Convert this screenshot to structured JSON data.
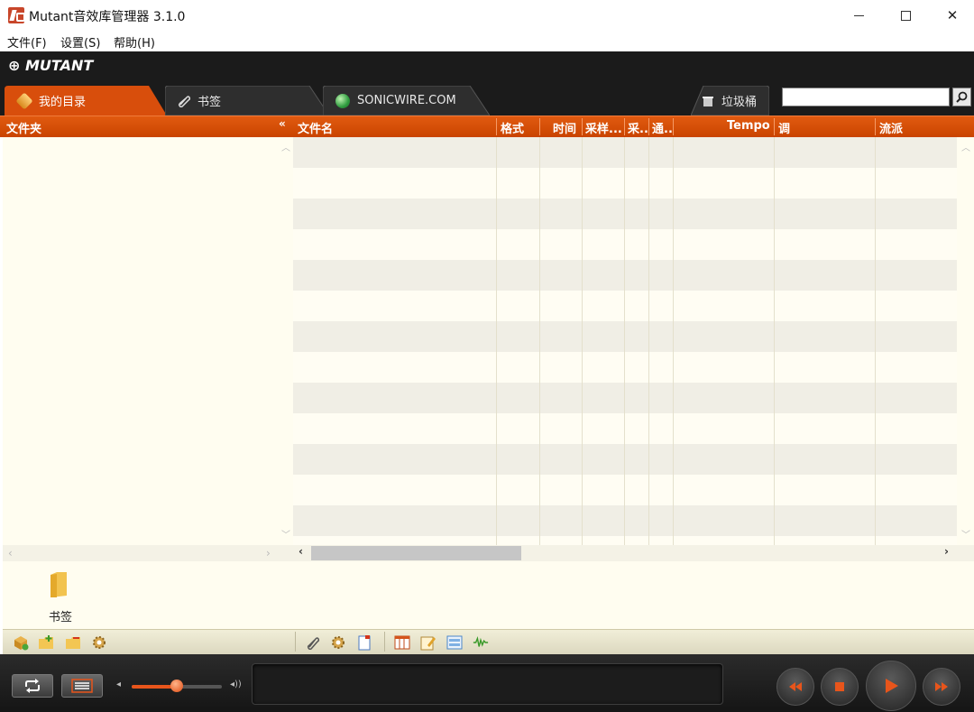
{
  "window": {
    "title": "Mutant音效库管理器 3.1.0",
    "controls": [
      "minimize",
      "maximize",
      "close"
    ]
  },
  "menu": {
    "items": [
      "文件(F)",
      "设置(S)",
      "帮助(H)"
    ]
  },
  "brand": {
    "logo_text": "MUTANT"
  },
  "tabs": {
    "items": [
      {
        "label": "我的目录",
        "icon": "box-icon",
        "active": true
      },
      {
        "label": "书签",
        "icon": "paperclip-icon",
        "active": false
      },
      {
        "label": "SONICWIRE.COM",
        "icon": "globe-icon",
        "active": false
      },
      {
        "label": "垃圾桶",
        "icon": "trash-icon",
        "active": false
      }
    ]
  },
  "search": {
    "value": "",
    "icon": "search-icon"
  },
  "folder_pane": {
    "header": "文件夹",
    "collapse": "«"
  },
  "table": {
    "columns": [
      "文件名",
      "格式",
      "时间",
      "采样...",
      "采...",
      "通...",
      "Tempo",
      "调",
      "流派"
    ],
    "rows": []
  },
  "bookmarks": {
    "items": [
      {
        "label": "书签",
        "icon": "folder-icon"
      }
    ]
  },
  "toolbar": {
    "left_icons": [
      "add-catalog-icon",
      "new-folder-icon",
      "remove-folder-icon",
      "folder-settings-icon"
    ],
    "right_icons": [
      "bookmark-icon",
      "file-settings-icon",
      "file-info-icon",
      "columns-icon",
      "edit-icon",
      "layout-icon",
      "waveform-icon"
    ]
  },
  "player": {
    "volume": 0.5,
    "buttons": [
      "loop-icon",
      "playlist-icon",
      "rewind-icon",
      "stop-icon",
      "play-icon",
      "forward-icon"
    ]
  },
  "colors": {
    "accent": "#d84e0c",
    "dark": "#1b1b1b",
    "pane_bg": "#fffdf0"
  }
}
